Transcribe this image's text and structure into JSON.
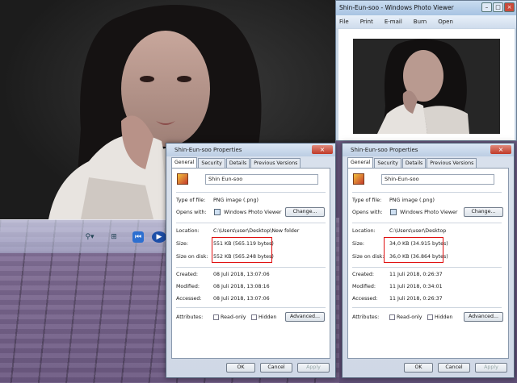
{
  "photo_viewer": {
    "title": "Shin-Eun-soo - Windows Photo Viewer",
    "menu": [
      "File",
      "Print",
      "E-mail",
      "Burn",
      "Open"
    ],
    "controls": {
      "zoom": "⚲▾",
      "fit": "⊞",
      "prev": "⏮",
      "play": "▶"
    }
  },
  "dialog_left": {
    "title": "Shin-Eun-soo Properties",
    "tabs": [
      "General",
      "Security",
      "Details",
      "Previous Versions"
    ],
    "file_name": "Shin Eun-soo",
    "type_label": "Type of file:",
    "type_value": "PNG image (.png)",
    "opens_label": "Opens with:",
    "opens_value": "Windows Photo Viewer",
    "change": "Change...",
    "location_label": "Location:",
    "location_value": "C:\\Users\\user\\Desktop\\New folder",
    "size_label": "Size:",
    "size_value": "551 KB (565.119 bytes)",
    "disk_label": "Size on disk:",
    "disk_value": "552 KB (565.248 bytes)",
    "created_label": "Created:",
    "created_value": "08 Juli 2018, 13:07:06",
    "modified_label": "Modified:",
    "modified_value": "08 Juli 2018, 13:08:16",
    "accessed_label": "Accessed:",
    "accessed_value": "08 Juli 2018, 13:07:06",
    "attr_label": "Attributes:",
    "readonly": "Read-only",
    "hidden": "Hidden",
    "advanced": "Advanced...",
    "ok": "OK",
    "cancel": "Cancel",
    "apply": "Apply"
  },
  "dialog_right": {
    "title": "Shin-Eun-soo Properties",
    "tabs": [
      "General",
      "Security",
      "Details",
      "Previous Versions"
    ],
    "file_name": "Shin-Eun-soo",
    "type_label": "Type of file:",
    "type_value": "PNG image (.png)",
    "opens_label": "Opens with:",
    "opens_value": "Windows Photo Viewer",
    "change": "Change...",
    "location_label": "Location:",
    "location_value": "C:\\Users\\user\\Desktop",
    "size_label": "Size:",
    "size_value": "34,0 KB (34.915 bytes)",
    "disk_label": "Size on disk:",
    "disk_value": "36,0 KB (36.864 bytes)",
    "created_label": "Created:",
    "created_value": "11 Juli 2018, 0:26:37",
    "modified_label": "Modified:",
    "modified_value": "11 Juli 2018, 0:34:01",
    "accessed_label": "Accessed:",
    "accessed_value": "11 Juli 2018, 0:26:37",
    "attr_label": "Attributes:",
    "readonly": "Read-only",
    "hidden": "Hidden",
    "advanced": "Advanced...",
    "ok": "OK",
    "cancel": "Cancel",
    "apply": "Apply"
  },
  "colors": {
    "highlight": "#e01010"
  }
}
